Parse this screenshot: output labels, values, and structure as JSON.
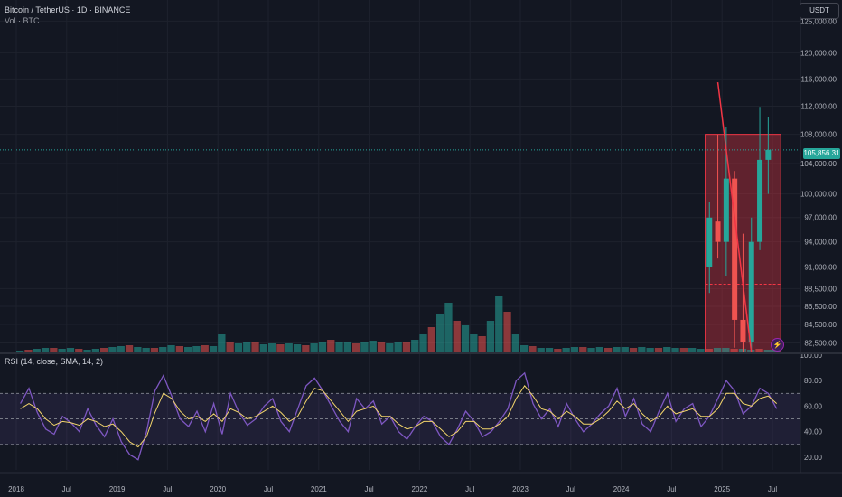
{
  "header": {
    "title": "Bitcoin / TetherUS · 1D · BINANCE",
    "volume_label": "Vol · BTC"
  },
  "currency_button": "USDT",
  "last_price_label": "105,856.31",
  "rsi_legend": "RSI (14, close, SMA, 14, 2)",
  "colors": {
    "background": "#131722",
    "grid": "#1e222d",
    "up": "#26a69a",
    "down": "#ef5350",
    "rsi": "#7e57c2",
    "rsi_ma": "#f3d56b",
    "rsi_band": "#7e57c2",
    "drawing": "#f23645"
  },
  "chart_data": [
    {
      "type": "bar",
      "name": "price",
      "y_scale": "log",
      "ylim": [
        81500,
        128000
      ],
      "y_ticks": [
        125000,
        120000,
        116000,
        112000,
        108000,
        104000,
        100000,
        97000,
        94000,
        91000,
        88500,
        86500,
        84500,
        82500
      ],
      "y_tick_labels": [
        "125,000.00",
        "120,000.00",
        "116,000.00",
        "112,000.00",
        "108,000.00",
        "104,000.00",
        "100,000.00",
        "97,000.00",
        "94,000.00",
        "91,000.00",
        "88,500.00",
        "86,500.00",
        "84,500.00",
        "82,500.00"
      ],
      "x_ticks": [
        "2018",
        "Jul",
        "2019",
        "Jul",
        "2020",
        "Jul",
        "2021",
        "Jul",
        "2022",
        "Jul",
        "2023",
        "Jul",
        "2024",
        "Jul",
        "2025",
        "Jul"
      ],
      "candles": [
        {
          "date": "2024-11",
          "open": 91000,
          "high": 99000,
          "low": 88000,
          "close": 97000
        },
        {
          "date": "2024-12",
          "open": 96500,
          "high": 108000,
          "low": 92000,
          "close": 94000
        },
        {
          "date": "2025-01",
          "open": 94000,
          "high": 109000,
          "low": 90000,
          "close": 102000
        },
        {
          "date": "2025-02",
          "open": 102000,
          "high": 103000,
          "low": 82000,
          "close": 85000
        },
        {
          "date": "2025-03",
          "open": 85000,
          "high": 95000,
          "low": 81500,
          "close": 82600
        },
        {
          "date": "2025-04",
          "open": 82600,
          "high": 97000,
          "low": 81500,
          "close": 94000
        },
        {
          "date": "2025-05",
          "open": 94000,
          "high": 111900,
          "low": 93000,
          "close": 104500
        },
        {
          "date": "2025-06",
          "open": 104500,
          "high": 110500,
          "low": 100000,
          "close": 105856
        }
      ],
      "last_price": 105856.31,
      "range_box": {
        "from": "2024-11",
        "to": "2025-07",
        "top": 108000,
        "bottom": 81500,
        "mid": 89000
      },
      "trend_line": {
        "from": {
          "date": "2024-12",
          "price": 115500
        },
        "to": {
          "date": "2025-04",
          "price": 81500
        }
      }
    },
    {
      "type": "bar",
      "name": "Vol · BTC",
      "x_ticks": [
        "2018",
        "Jul",
        "2019",
        "Jul",
        "2020",
        "Jul",
        "2021",
        "Jul",
        "2022",
        "Jul",
        "2023",
        "Jul",
        "2024",
        "Jul",
        "2025",
        "Jul"
      ],
      "monthly_volume_relative": [
        0.02,
        0.03,
        0.04,
        0.05,
        0.05,
        0.04,
        0.05,
        0.04,
        0.03,
        0.04,
        0.05,
        0.06,
        0.07,
        0.08,
        0.06,
        0.05,
        0.05,
        0.06,
        0.08,
        0.07,
        0.06,
        0.07,
        0.08,
        0.07,
        0.2,
        0.12,
        0.1,
        0.12,
        0.11,
        0.09,
        0.1,
        0.09,
        0.1,
        0.09,
        0.08,
        0.1,
        0.12,
        0.14,
        0.12,
        0.11,
        0.1,
        0.12,
        0.13,
        0.11,
        0.1,
        0.11,
        0.12,
        0.14,
        0.2,
        0.28,
        0.42,
        0.55,
        0.35,
        0.3,
        0.2,
        0.18,
        0.35,
        0.62,
        0.45,
        0.2,
        0.08,
        0.07,
        0.05,
        0.05,
        0.04,
        0.05,
        0.06,
        0.06,
        0.05,
        0.06,
        0.05,
        0.06,
        0.06,
        0.05,
        0.06,
        0.05,
        0.05,
        0.06,
        0.05,
        0.05,
        0.05,
        0.04,
        0.04,
        0.05,
        0.05,
        0.04,
        0.04,
        0.03,
        0.04,
        0.03,
        0.03
      ]
    },
    {
      "type": "line",
      "name": "RSI (14, close, SMA, 14, 2)",
      "ylim": [
        10,
        100
      ],
      "y_ticks": [
        100,
        80,
        60,
        40,
        20
      ],
      "y_tick_labels": [
        "100.00",
        "80.00",
        "60.00",
        "40.00",
        "20.00"
      ],
      "band": [
        30,
        70
      ],
      "midline": 50,
      "x_ticks": [
        "2018",
        "Jul",
        "2019",
        "Jul",
        "2020",
        "Jul",
        "2021",
        "Jul",
        "2022",
        "Jul",
        "2023",
        "Jul",
        "2024",
        "Jul",
        "2025",
        "Jul"
      ],
      "series": [
        {
          "values": [
            62,
            74,
            55,
            42,
            38,
            52,
            47,
            40,
            58,
            45,
            36,
            50,
            32,
            22,
            18,
            40,
            72,
            84,
            68,
            50,
            44,
            56,
            40,
            62,
            38,
            70,
            55,
            45,
            50,
            60,
            66,
            48,
            40,
            58,
            76,
            82,
            72,
            60,
            48,
            40,
            66,
            58,
            64,
            46,
            52,
            40,
            34,
            44,
            52,
            48,
            36,
            30,
            42,
            56,
            48,
            36,
            40,
            48,
            58,
            80,
            86,
            62,
            50,
            58,
            44,
            62,
            50,
            40,
            46,
            54,
            60,
            74,
            52,
            66,
            46,
            40,
            56,
            70,
            48,
            58,
            62,
            44,
            52,
            66,
            80,
            72,
            54,
            60,
            74,
            70,
            58
          ]
        },
        {
          "values": [
            58,
            62,
            58,
            50,
            45,
            48,
            47,
            45,
            50,
            48,
            44,
            46,
            40,
            32,
            28,
            36,
            55,
            70,
            66,
            56,
            50,
            52,
            48,
            54,
            48,
            58,
            55,
            50,
            52,
            56,
            60,
            55,
            48,
            52,
            64,
            74,
            72,
            64,
            56,
            48,
            56,
            58,
            60,
            52,
            52,
            46,
            42,
            44,
            48,
            48,
            42,
            36,
            40,
            48,
            48,
            42,
            42,
            46,
            52,
            66,
            76,
            68,
            58,
            56,
            50,
            56,
            52,
            46,
            46,
            50,
            56,
            64,
            58,
            62,
            54,
            48,
            52,
            60,
            54,
            56,
            58,
            52,
            52,
            58,
            70,
            70,
            62,
            60,
            66,
            68,
            62
          ]
        }
      ]
    }
  ]
}
